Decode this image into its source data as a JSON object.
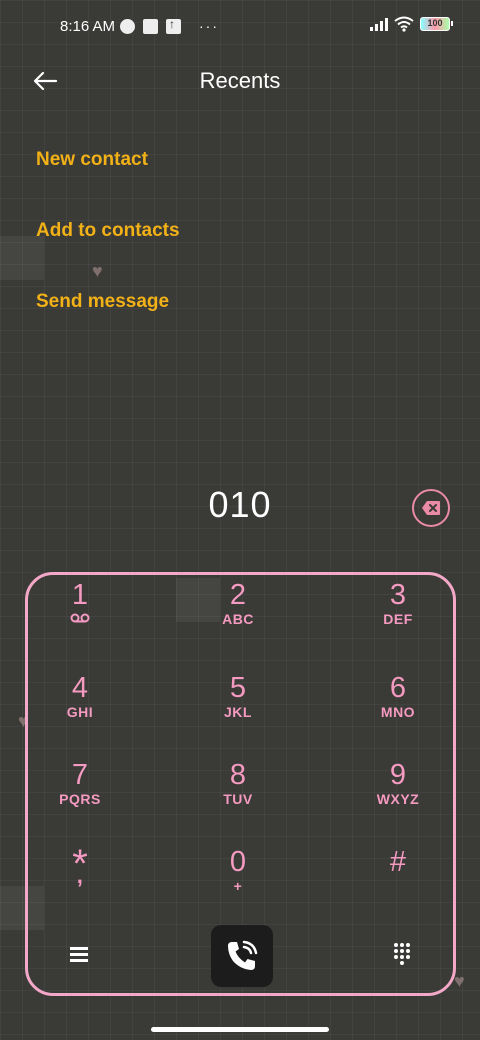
{
  "status_bar": {
    "time": "8:16 AM",
    "overflow": "···",
    "battery_level": "100",
    "icons": [
      "notification-icon",
      "square-icon",
      "upload-icon",
      "signal-icon",
      "wifi-icon",
      "battery-icon"
    ]
  },
  "header": {
    "title": "Recents",
    "back_icon": "back-arrow-icon"
  },
  "actions": {
    "new_contact": "New contact",
    "add_to_contacts": "Add to contacts",
    "send_message": "Send message"
  },
  "dialer": {
    "number": "010",
    "backspace_icon": "backspace-icon"
  },
  "keypad": {
    "keys": [
      {
        "digit": "1",
        "sub": ""
      },
      {
        "digit": "2",
        "sub": "ABC"
      },
      {
        "digit": "3",
        "sub": "DEF"
      },
      {
        "digit": "4",
        "sub": "GHI"
      },
      {
        "digit": "5",
        "sub": "JKL"
      },
      {
        "digit": "6",
        "sub": "MNO"
      },
      {
        "digit": "7",
        "sub": "PQRS"
      },
      {
        "digit": "8",
        "sub": "TUV"
      },
      {
        "digit": "9",
        "sub": "WXYZ"
      },
      {
        "digit": "*",
        "sub": ","
      },
      {
        "digit": "0",
        "sub": "+"
      },
      {
        "digit": "#",
        "sub": ""
      }
    ],
    "voicemail_icon": "voicemail-icon",
    "menu_icon": "menu-icon",
    "call_icon": "phone-call-icon",
    "dialpad_icon": "dialpad-icon"
  },
  "colors": {
    "background": "#3a3a37",
    "accent_action": "#f2b116",
    "keypad_text": "#f59ac0",
    "keypad_border": "#f4a8c8",
    "call_button": "#1c1c1c"
  }
}
